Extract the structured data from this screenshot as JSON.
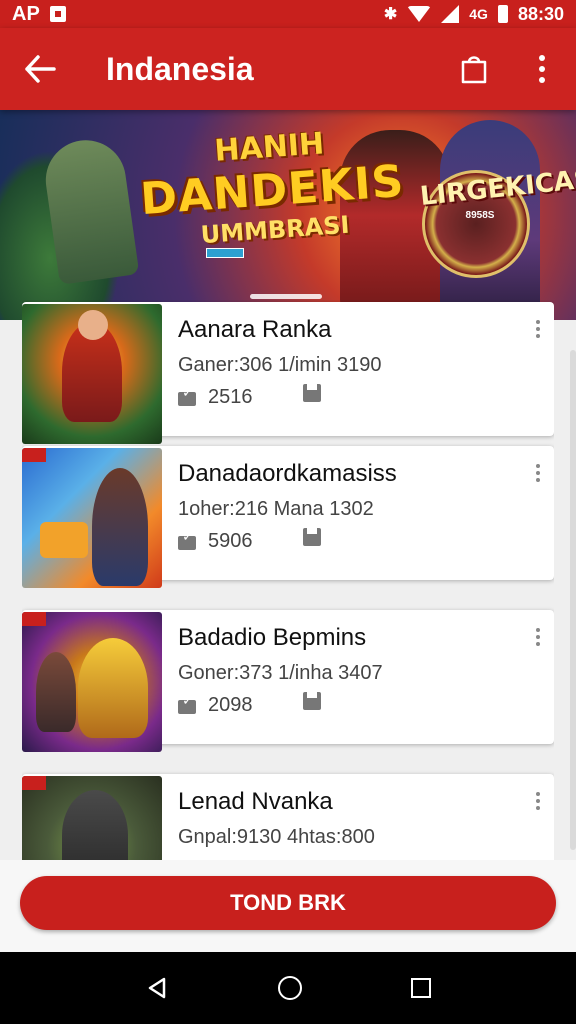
{
  "status_bar": {
    "left_text": "AP",
    "time": "88:30",
    "extra_label": "4G"
  },
  "app_bar": {
    "title": "Indanesia"
  },
  "banner": {
    "line1": "HANIH",
    "line2": "DANDEKIS",
    "line3": "UMMBRASI",
    "badge_text": "LIRGEKICAS",
    "badge_sub": "8958S"
  },
  "games": [
    {
      "title": "Aanara Ranka",
      "meta": "Ganer:306 1/imin 3190",
      "count": "2516"
    },
    {
      "title": "Danadaordkamasiss",
      "meta": "1oher:216 Mana 1302",
      "count": "5906"
    },
    {
      "title": "Badadio Bepmins",
      "meta": "Goner:373 1/inha 3407",
      "count": "2098"
    },
    {
      "title": "Lenad Nvanka",
      "meta": "Gnpal:9130 4htas:800",
      "count": ""
    }
  ],
  "cta": {
    "label": "TOND BRK"
  },
  "colors": {
    "primary": "#cc2320",
    "card_bg": "#ffffff",
    "page_bg": "#efefef"
  }
}
